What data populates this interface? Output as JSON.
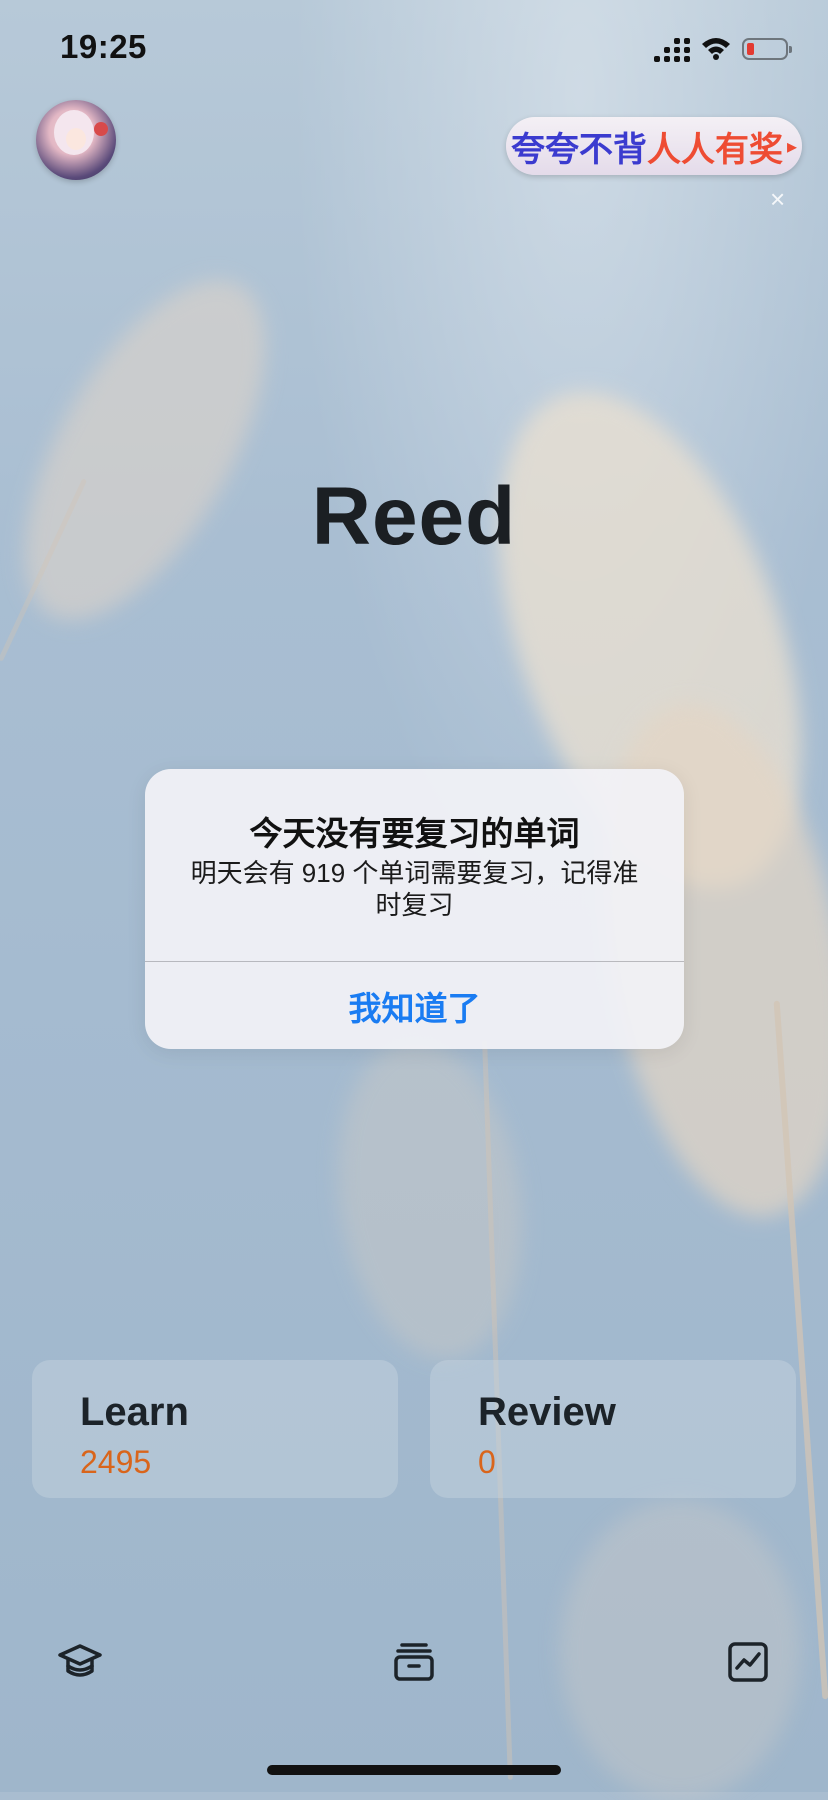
{
  "status_bar": {
    "time": "19:25"
  },
  "header": {
    "promo_text_part1": "夸夸不背",
    "promo_text_part2": "人人有奖",
    "promo_arrow": "▸",
    "promo_close": "×"
  },
  "main": {
    "title": "Reed"
  },
  "dialog": {
    "title": "今天没有要复习的单词",
    "message": "明天会有 919 个单词需要复习，记得准时复习",
    "button": "我知道了"
  },
  "cards": {
    "learn": {
      "label": "Learn",
      "value": "2495"
    },
    "review": {
      "label": "Review",
      "value": "0"
    }
  },
  "tabbar": {
    "items": [
      {
        "icon": "graduation-cap-icon"
      },
      {
        "icon": "archive-box-icon"
      },
      {
        "icon": "chart-icon"
      }
    ]
  },
  "colors": {
    "accent_blue": "#1a7cf2",
    "count_orange": "#d9651b",
    "promo_blue": "#3b3bcf",
    "promo_red": "#ee4c33",
    "battery_low": "#e23b32"
  }
}
